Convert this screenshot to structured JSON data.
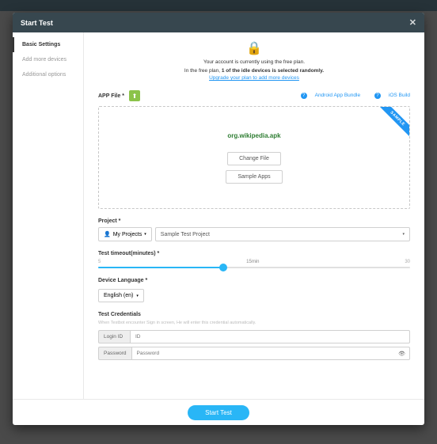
{
  "modal": {
    "title": "Start Test",
    "close_glyph": "✕"
  },
  "sidebar": {
    "items": [
      {
        "label": "Basic Settings",
        "active": true
      },
      {
        "label": "Add more devices",
        "active": false
      },
      {
        "label": "Additional options",
        "active": false
      }
    ]
  },
  "account": {
    "line1": "Your account is currently using the free plan.",
    "line2_pre": "In the free plan, ",
    "line2_bold": "1 of the idle devices is selected randomly.",
    "upgrade": "Upgrade your plan to add more devices"
  },
  "app_file": {
    "label": "APP File *",
    "help_aab": "Android App Bundle",
    "help_ios": "iOS Build",
    "ribbon": "SAMPLE",
    "filename": "org.wikipedia.apk",
    "change_btn": "Change File",
    "sample_btn": "Sample Apps"
  },
  "project": {
    "label": "Project *",
    "dd_label": "My Projects",
    "selected": "Sample Test Project"
  },
  "timeout": {
    "label": "Test timeout(minutes) *",
    "min": "5",
    "mid": "15min",
    "max": "30"
  },
  "language": {
    "label": "Device Language *",
    "selected": "English (en)"
  },
  "credentials": {
    "label": "Test Credentials",
    "hint": "When Testbot encounter Sign in screen, He will enter this credential automatically.",
    "login_lbl": "Login ID",
    "login_ph": "ID",
    "pw_lbl": "Password",
    "pw_ph": "Password"
  },
  "footer": {
    "start": "Start Test"
  },
  "icons": {
    "lock": "🔒",
    "android_up": "⬆",
    "person": "👤",
    "caret": "▾",
    "eye": "👁",
    "q": "?"
  }
}
